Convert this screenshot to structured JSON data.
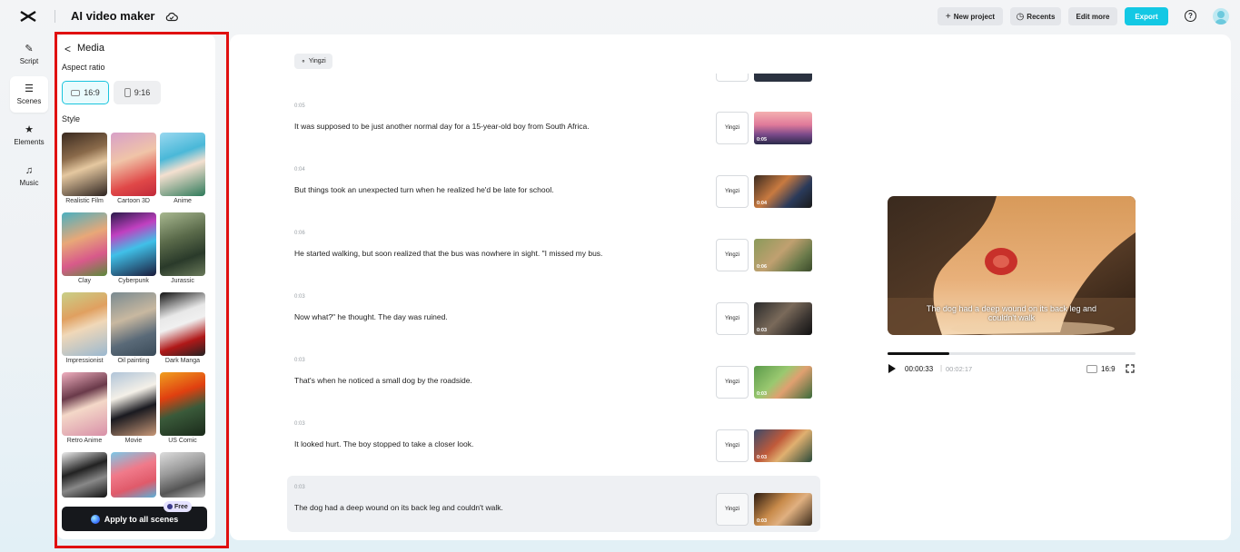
{
  "topbar": {
    "title": "AI video maker",
    "new_project": "New project",
    "recents": "Recents",
    "edit_more": "Edit more",
    "export": "Export",
    "help": "?"
  },
  "rail": [
    {
      "label": "Script",
      "icon": "script-icon"
    },
    {
      "label": "Scenes",
      "icon": "scenes-icon",
      "active": true
    },
    {
      "label": "Elements",
      "icon": "elements-icon"
    },
    {
      "label": "Music",
      "icon": "music-icon"
    }
  ],
  "media": {
    "back": "<",
    "title": "Media",
    "aspect_label": "Aspect ratio",
    "aspect_16_9": "16:9",
    "aspect_9_16": "9:16",
    "aspect_selected": "16:9",
    "style_label": "Style",
    "styles": [
      "Realistic Film",
      "Cartoon 3D",
      "Anime",
      "Clay",
      "Cyberpunk",
      "Jurassic",
      "Impressionist",
      "Oil painting",
      "Dark Manga",
      "Retro Anime",
      "Movie",
      "US Comic"
    ],
    "apply": "Apply to all scenes",
    "free_badge": "Free"
  },
  "script": {
    "voice": "Yingzi",
    "scenes": [
      {
        "duration": "0:05",
        "text": "It was supposed to be just another normal day for a 15-year-old boy from South Africa.",
        "voice": "Yingzi",
        "thumb_time": "0:05"
      },
      {
        "duration": "0:04",
        "text": "But things took an unexpected turn when he realized he'd be late for school.",
        "voice": "Yingzi",
        "thumb_time": "0:04"
      },
      {
        "duration": "0:06",
        "text": "He started walking, but soon realized that the bus was nowhere in sight. \"I missed my bus.",
        "voice": "Yingzi",
        "thumb_time": "0:06"
      },
      {
        "duration": "0:03",
        "text": "Now what?\" he thought. The day was ruined.",
        "voice": "Yingzi",
        "thumb_time": "0:03"
      },
      {
        "duration": "0:03",
        "text": "That's when he noticed a small dog by the roadside.",
        "voice": "Yingzi",
        "thumb_time": "0:03"
      },
      {
        "duration": "0:03",
        "text": "It looked hurt. The boy stopped to take a closer look.",
        "voice": "Yingzi",
        "thumb_time": "0:03"
      },
      {
        "duration": "0:03",
        "text": "The dog had a deep wound on its back leg and couldn't walk.",
        "voice": "Yingzi",
        "thumb_time": "0:03",
        "selected": true
      }
    ]
  },
  "preview": {
    "subtitle_line1": "The dog had a deep wound on its back leg and",
    "subtitle_line2": "couldn't walk",
    "current_time": "00:00:33",
    "separator": "|",
    "total_time": "00:02:17",
    "progress": 0.25,
    "ratio": "16:9"
  },
  "colors": {
    "accent": "#13c8e4",
    "highlight": "#e01010"
  }
}
